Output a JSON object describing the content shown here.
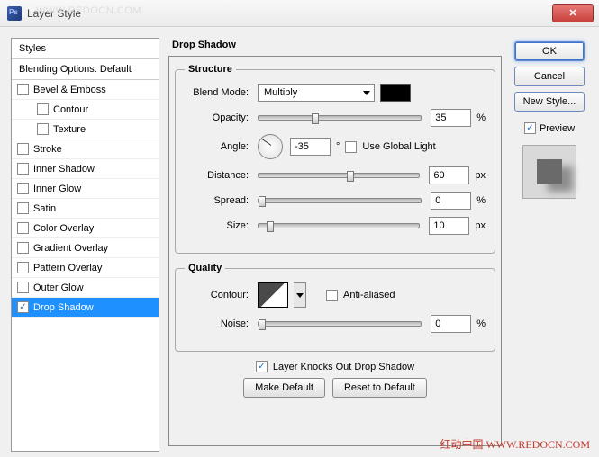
{
  "window": {
    "title": "Layer Style",
    "watermark_top": "WWW.REDOCN.COM",
    "watermark_bottom": "红动中国  WWW.REDOCN.COM",
    "close_glyph": "✕"
  },
  "sidebar": {
    "header": "Styles",
    "blending": "Blending Options: Default",
    "items": [
      {
        "label": "Bevel & Emboss",
        "checked": false
      },
      {
        "label": "Contour",
        "checked": false,
        "child": true
      },
      {
        "label": "Texture",
        "checked": false,
        "child": true
      },
      {
        "label": "Stroke",
        "checked": false
      },
      {
        "label": "Inner Shadow",
        "checked": false
      },
      {
        "label": "Inner Glow",
        "checked": false
      },
      {
        "label": "Satin",
        "checked": false
      },
      {
        "label": "Color Overlay",
        "checked": false
      },
      {
        "label": "Gradient Overlay",
        "checked": false
      },
      {
        "label": "Pattern Overlay",
        "checked": false
      },
      {
        "label": "Outer Glow",
        "checked": false
      },
      {
        "label": "Drop Shadow",
        "checked": true,
        "selected": true
      }
    ]
  },
  "center": {
    "title": "Drop Shadow",
    "structure_legend": "Structure",
    "quality_legend": "Quality",
    "labels": {
      "blend_mode": "Blend Mode:",
      "opacity": "Opacity:",
      "angle": "Angle:",
      "distance": "Distance:",
      "spread": "Spread:",
      "size": "Size:",
      "contour": "Contour:",
      "noise": "Noise:"
    },
    "units": {
      "pct": "%",
      "px": "px",
      "deg": "°"
    },
    "values": {
      "blend_mode": "Multiply",
      "opacity": "35",
      "angle": "-35",
      "distance": "60",
      "spread": "0",
      "size": "10",
      "noise": "0",
      "color": "#000000"
    },
    "checks": {
      "global_light": "Use Global Light",
      "global_light_checked": false,
      "anti_aliased": "Anti-aliased",
      "anti_aliased_checked": false,
      "knockout": "Layer Knocks Out Drop Shadow",
      "knockout_checked": true
    },
    "buttons": {
      "make_default": "Make Default",
      "reset_default": "Reset to Default"
    }
  },
  "right": {
    "ok": "OK",
    "cancel": "Cancel",
    "new_style": "New Style...",
    "preview": "Preview",
    "preview_checked": true
  }
}
